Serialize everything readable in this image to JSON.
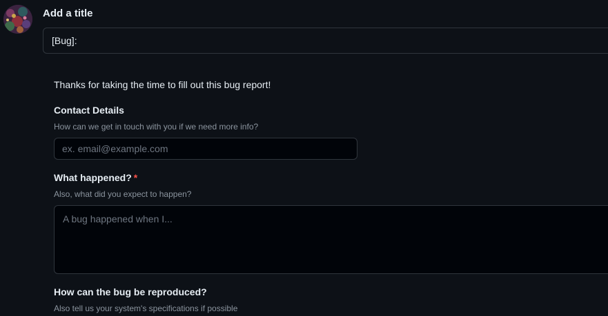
{
  "user": {
    "avatar_alt": "user avatar"
  },
  "title_section": {
    "label": "Add a title",
    "value": "[Bug]: "
  },
  "form": {
    "intro": "Thanks for taking the time to fill out this bug report!",
    "contact": {
      "label": "Contact Details",
      "description": "How can we get in touch with you if we need more info?",
      "placeholder": "ex. email@example.com"
    },
    "what_happened": {
      "label": "What happened?",
      "required_marker": "*",
      "description": "Also, what did you expect to happen?",
      "placeholder": "A bug happened when I..."
    },
    "reproduce": {
      "label": "How can the bug be reproduced?",
      "description": "Also tell us your system's specifications if possible"
    }
  },
  "colors": {
    "background": "#0d1117",
    "input_background": "#010409",
    "border": "#30363d",
    "muted_text": "#8b949e",
    "required": "#f85149"
  }
}
